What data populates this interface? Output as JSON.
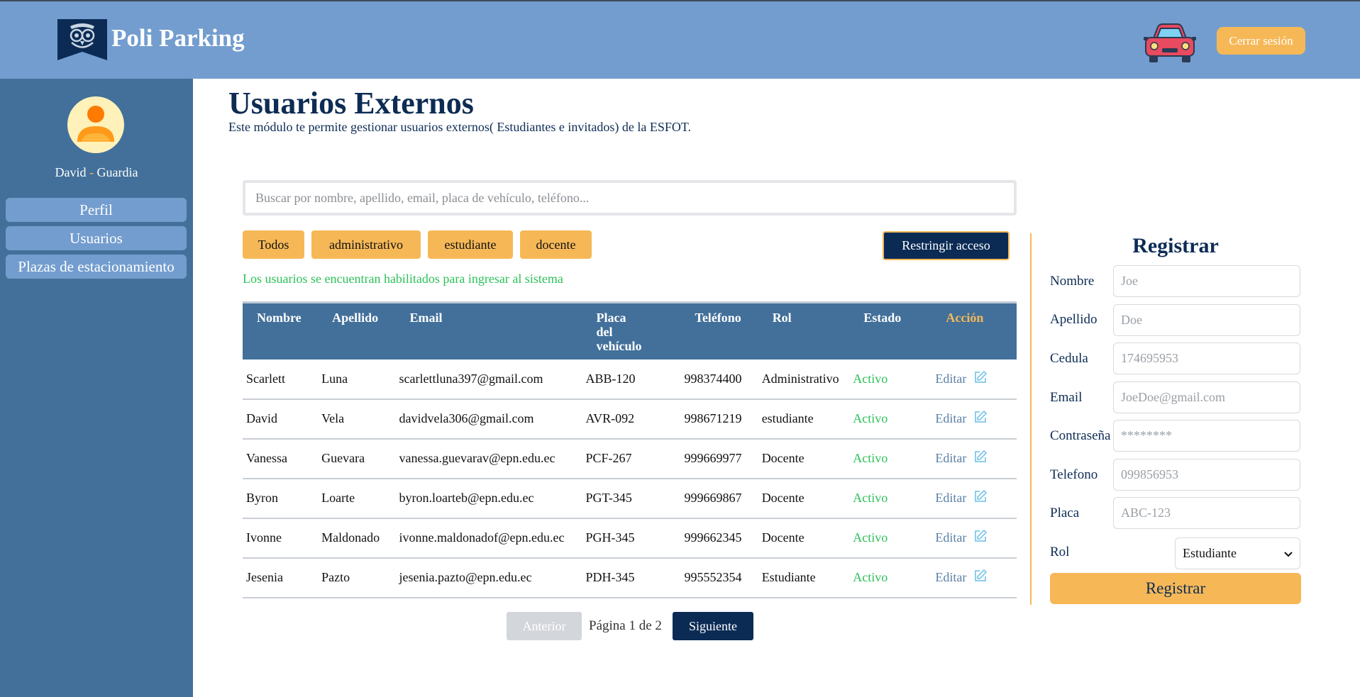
{
  "header": {
    "brand": "Poli Parking",
    "logout_label": "Cerrar sesión"
  },
  "sidebar": {
    "user_name": "David",
    "user_sep": "-",
    "user_role": "Guardia",
    "items": [
      {
        "label": "Perfil"
      },
      {
        "label": "Usuarios"
      },
      {
        "label": "Plazas de estacionamiento"
      }
    ]
  },
  "main": {
    "title": "Usuarios Externos",
    "subtitle": "Este módulo te permite gestionar usuarios externos( Estudiantes e invitados) de la ESFOT.",
    "search_placeholder": "Buscar por nombre, apellido, email, placa de vehículo, teléfono...",
    "filters": [
      "Todos",
      "administrativo",
      "estudiante",
      "docente"
    ],
    "restrict_label": "Restringir acceso",
    "notice": "Los usuarios se encuentran habilitados para ingresar al sistema",
    "columns": [
      "Nombre",
      "Apellido",
      "Email",
      "Placa del vehículo",
      "Teléfono",
      "Rol",
      "Estado",
      "Acción"
    ],
    "rows": [
      [
        "Scarlett",
        "Luna",
        "scarlettluna397@gmail.com",
        "ABB-120",
        "998374400",
        "Administrativo",
        "Activo",
        "Editar"
      ],
      [
        "David",
        "Vela",
        "davidvela306@gmail.com",
        "AVR-092",
        "998671219",
        "estudiante",
        "Activo",
        "Editar"
      ],
      [
        "Vanessa",
        "Guevara",
        "vanessa.guevarav@epn.edu.ec",
        "PCF-267",
        "999669977",
        "Docente",
        "Activo",
        "Editar"
      ],
      [
        "Byron",
        "Loarte",
        "byron.loarteb@epn.edu.ec",
        "PGT-345",
        "999669867",
        "Docente",
        "Activo",
        "Editar"
      ],
      [
        "Ivonne",
        "Maldonado",
        "ivonne.maldonadof@epn.edu.ec",
        "PGH-345",
        "999662345",
        "Docente",
        "Activo",
        "Editar"
      ],
      [
        "Jesenia",
        "Pazto",
        "jesenia.pazto@epn.edu.ec",
        "PDH-345",
        "995552354",
        "Estudiante",
        "Activo",
        "Editar"
      ]
    ],
    "pagination": {
      "prev_label": "Anterior",
      "page_label": "Página 1 de 2",
      "next_label": "Siguiente"
    }
  },
  "register": {
    "title": "Registrar",
    "fields": [
      {
        "label": "Nombre",
        "placeholder": "Joe"
      },
      {
        "label": "Apellido",
        "placeholder": "Doe"
      },
      {
        "label": "Cedula",
        "placeholder": "174695953"
      },
      {
        "label": "Email",
        "placeholder": "JoeDoe@gmail.com"
      },
      {
        "label": "Contraseña",
        "placeholder": "********"
      },
      {
        "label": "Telefono",
        "placeholder": "099856953"
      },
      {
        "label": "Placa",
        "placeholder": "ABC-123"
      }
    ],
    "rol_label": "Rol",
    "rol_value": "Estudiante",
    "submit_label": "Registrar"
  },
  "icons": {
    "logo": "owl-logo-icon",
    "car": "car-icon",
    "avatar": "user-avatar-icon",
    "edit": "edit-icon",
    "select": "chevron-down-icon"
  },
  "colors": {
    "header": "#739dce",
    "sidebar": "#42709a",
    "accent": "#f6b857",
    "navy": "#0b2b55",
    "active": "#2ec05a"
  }
}
